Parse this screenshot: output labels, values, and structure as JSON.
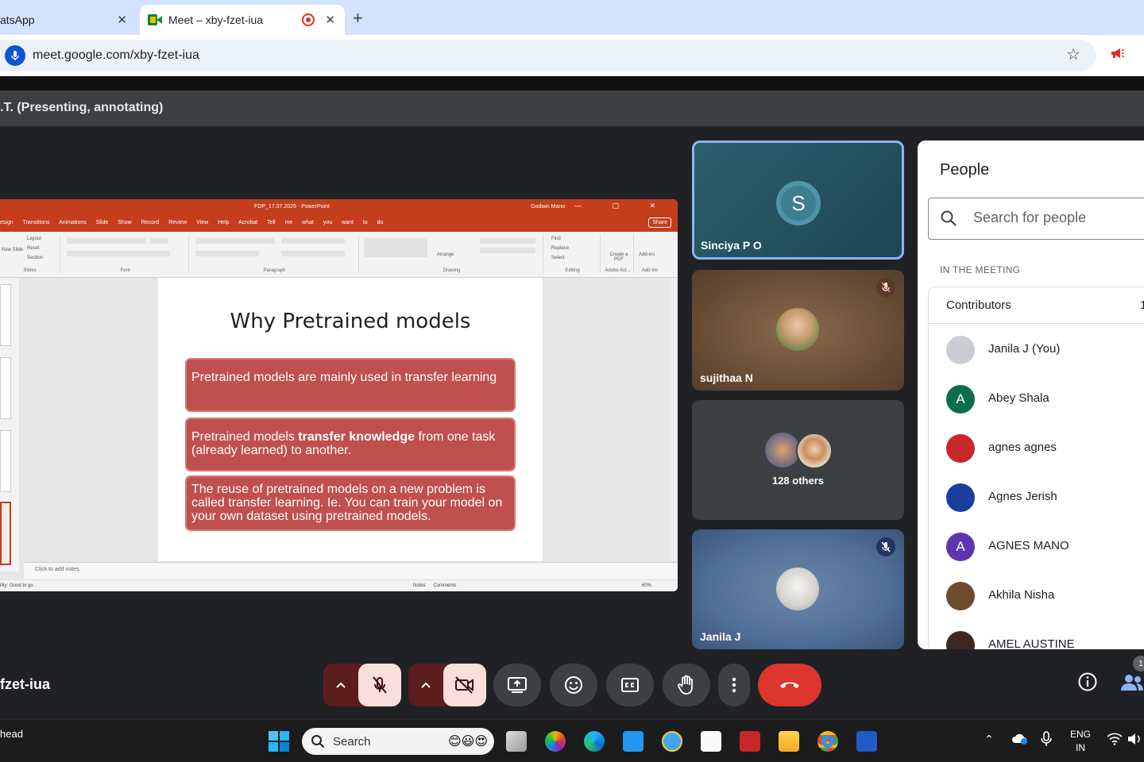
{
  "browser": {
    "tabs": [
      {
        "label": "atsApp",
        "active": false
      },
      {
        "label": "Meet – xby-fzet-iua",
        "active": true
      }
    ],
    "new_tab": "+",
    "close_glyph": "✕",
    "url": "meet.google.com/xby-fzet-iua"
  },
  "meet": {
    "presenting_label": ".T. (Presenting, annotating)",
    "meeting_code": "fzet-iua",
    "participant_count_badge": "1"
  },
  "presentation": {
    "titlebar": "FDP_17.07.2025 - PowerPoint",
    "user": "Godwin Mano",
    "menu": [
      "esign",
      "Transitions",
      "Animations",
      "Slide Show",
      "Record",
      "Review",
      "View",
      "Help",
      "Acrobat",
      "Tell me what you want to do"
    ],
    "share_label": "Share",
    "ribbon_groups": [
      "Slides",
      "Font",
      "Paragraph",
      "Drawing",
      "Editing",
      "Adobe Acr...",
      "Add-ins"
    ],
    "ribbon_buttons": {
      "layout": "Layout",
      "reset": "Reset",
      "section": "Section",
      "new_slide": "New Slide",
      "arrange": "Arrange",
      "find": "Find",
      "replace": "Replace",
      "select": "Select",
      "create_pdf": "Create a PDF",
      "addins": "Add-ins"
    },
    "slide_title": "Why Pretrained models",
    "boxes": [
      {
        "text": "Pretrained models are mainly used in transfer learning"
      },
      {
        "before": "Pretrained models ",
        "bold": "transfer knowledge",
        "after": " from one task (already learned) to another."
      },
      {
        "text": "The reuse of pretrained models on a new problem is called transfer learning. Ie. You can train your model on your own dataset using pretrained models."
      }
    ],
    "notes_placeholder": "Click to add notes",
    "status_left": "ility: Good to go",
    "status_right": "Notes  Comments",
    "zoom": "60%"
  },
  "tiles": [
    {
      "name": "Sinciya P O",
      "initial": "S"
    },
    {
      "name": "sujithaa N"
    },
    {
      "others": "128 others"
    },
    {
      "name": "Janila J"
    }
  ],
  "people_panel": {
    "title": "People",
    "search_placeholder": "Search for people",
    "section": "IN THE MEETING",
    "group_label": "Contributors",
    "group_count": "1",
    "people": [
      {
        "name": "Janila J (You)",
        "initial": "",
        "color": "#c9cdd4"
      },
      {
        "name": "Abey Shala",
        "initial": "A",
        "color": "#0b6e4f"
      },
      {
        "name": "agnes agnes",
        "initial": "",
        "color": "#c62828"
      },
      {
        "name": "Agnes Jerish",
        "initial": "",
        "color": "#1a3e9e"
      },
      {
        "name": "AGNES MANO",
        "initial": "A",
        "color": "#5e35b1"
      },
      {
        "name": "Akhila Nisha",
        "initial": "",
        "color": "#6d4c2f"
      },
      {
        "name": "AMEL AUSTINE",
        "initial": "",
        "color": "#3e2723"
      }
    ]
  },
  "taskbar": {
    "weather": "head",
    "search": "Search",
    "lang_line1": "ENG",
    "lang_line2": "IN"
  }
}
